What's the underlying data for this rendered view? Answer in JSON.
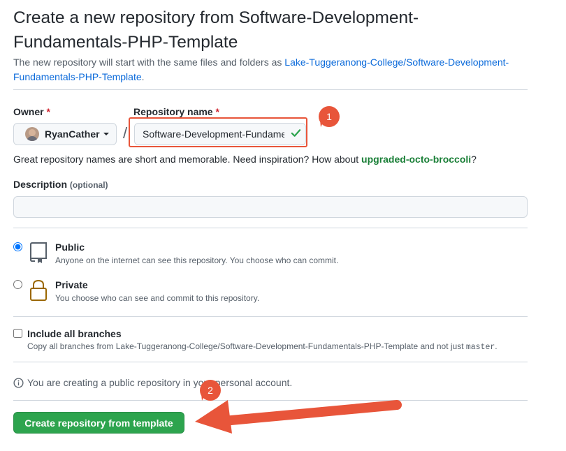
{
  "header": {
    "title": "Create a new repository from Software-Development-Fundamentals-PHP-Template",
    "subtitle_prefix": "The new repository will start with the same files and folders as ",
    "template_link": "Lake-Tuggeranong-College/Software-Development-Fundamentals-PHP-Template",
    "subtitle_suffix": "."
  },
  "owner": {
    "label": "Owner",
    "required_mark": "*",
    "value": "RyanCather"
  },
  "repository": {
    "label": "Repository name",
    "required_mark": "*",
    "value": "Software-Development-Fundamentals-PHP-Template",
    "separator": "/"
  },
  "hint": {
    "text": "Great repository names are short and memorable. Need inspiration? How about ",
    "suggestion": "upgraded-octo-broccoli",
    "suffix": "?"
  },
  "description": {
    "label": "Description",
    "optional": "(optional)",
    "value": ""
  },
  "visibility": {
    "selected": "public",
    "public_title": "Public",
    "public_desc": "Anyone on the internet can see this repository. You choose who can commit.",
    "private_title": "Private",
    "private_desc": "You choose who can see and commit to this repository."
  },
  "branches": {
    "title": "Include all branches",
    "desc_prefix": "Copy all branches from Lake-Tuggeranong-College/Software-Development-Fundamentals-PHP-Template and not just ",
    "desc_code": "master",
    "desc_suffix": ".",
    "checked": false
  },
  "notice": {
    "text": "You are creating a public repository in your personal account."
  },
  "submit": {
    "label": "Create repository from template"
  },
  "annotations": {
    "step1": "1",
    "step2": "2",
    "color": "#e8553a"
  },
  "icons": {
    "check": "check-icon",
    "caret": "triangle-down-icon",
    "public": "repo-icon",
    "private": "lock-icon",
    "info": "info-icon"
  }
}
